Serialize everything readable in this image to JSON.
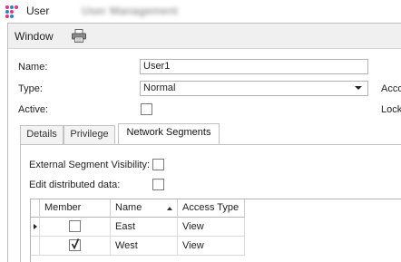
{
  "window": {
    "title": "User",
    "subtitle": "User Management"
  },
  "toolbar": {
    "menu_label": "Window",
    "print_icon": "printer-icon"
  },
  "form": {
    "name_label": "Name:",
    "name_value": "User1",
    "type_label": "Type:",
    "type_value": "Normal",
    "active_label": "Active:",
    "active_checked": false,
    "access_label": "Acco",
    "lock_label": "Lock"
  },
  "tabs": [
    {
      "label": "Details",
      "active": false
    },
    {
      "label": "Privilege",
      "active": false
    },
    {
      "label": "Network Segments",
      "active": true
    }
  ],
  "network": {
    "external_label": "External Segment Visibility:",
    "external_checked": false,
    "edit_distributed_label": "Edit distributed data:",
    "edit_distributed_checked": false,
    "columns": [
      "Member",
      "Name",
      "Access Type"
    ],
    "sort_column": "Name",
    "sort_direction": "ascending",
    "rows": [
      {
        "member": false,
        "name": "East",
        "access": "View",
        "current": true
      },
      {
        "member": true,
        "name": "West",
        "access": "View",
        "current": false
      }
    ]
  },
  "colors": {
    "logo_pink": "#e0367a",
    "logo_blue": "#2d7fd6",
    "border": "#b4b4b4"
  }
}
